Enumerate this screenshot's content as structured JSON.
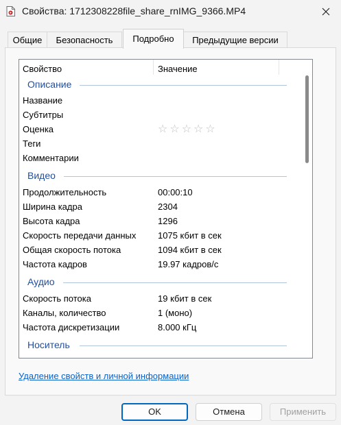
{
  "window": {
    "title": "Свойства: 1712308228file_share_rnIMG_9366.MP4",
    "icon": "video-file-icon",
    "close_icon": "close-icon"
  },
  "tabs": [
    {
      "label": "Общие",
      "active": false
    },
    {
      "label": "Безопасность",
      "active": false
    },
    {
      "label": "Подробно",
      "active": true
    },
    {
      "label": "Предыдущие версии",
      "active": false
    }
  ],
  "list": {
    "columns": {
      "property": "Свойство",
      "value": "Значение"
    },
    "sections": [
      {
        "title": "Описание",
        "rows": [
          {
            "name": "Название",
            "value": ""
          },
          {
            "name": "Субтитры",
            "value": ""
          },
          {
            "name": "Оценка",
            "value": "",
            "rating": 0,
            "max_rating": 5
          },
          {
            "name": "Теги",
            "value": ""
          },
          {
            "name": "Комментарии",
            "value": ""
          }
        ]
      },
      {
        "title": "Видео",
        "rows": [
          {
            "name": "Продолжительность",
            "value": "00:00:10"
          },
          {
            "name": "Ширина кадра",
            "value": "2304"
          },
          {
            "name": "Высота кадра",
            "value": "1296"
          },
          {
            "name": "Скорость передачи данных",
            "value": "1075 кбит в сек"
          },
          {
            "name": "Общая скорость потока",
            "value": "1094 кбит в сек"
          },
          {
            "name": "Частота кадров",
            "value": "19.97 кадров/с"
          }
        ]
      },
      {
        "title": "Аудио",
        "rows": [
          {
            "name": "Скорость потока",
            "value": "19 кбит в сек"
          },
          {
            "name": "Каналы, количество",
            "value": "1 (моно)"
          },
          {
            "name": "Частота дискретизации",
            "value": "8.000 кГц"
          }
        ]
      },
      {
        "title": "Носитель",
        "rows": []
      }
    ]
  },
  "remove_link": "Удаление свойств и личной информации",
  "buttons": {
    "ok": "OK",
    "cancel": "Отмена",
    "apply": "Применить"
  },
  "colors": {
    "accent": "#0067c0",
    "section_title": "#1f4e9e",
    "link": "#0a61c9"
  }
}
